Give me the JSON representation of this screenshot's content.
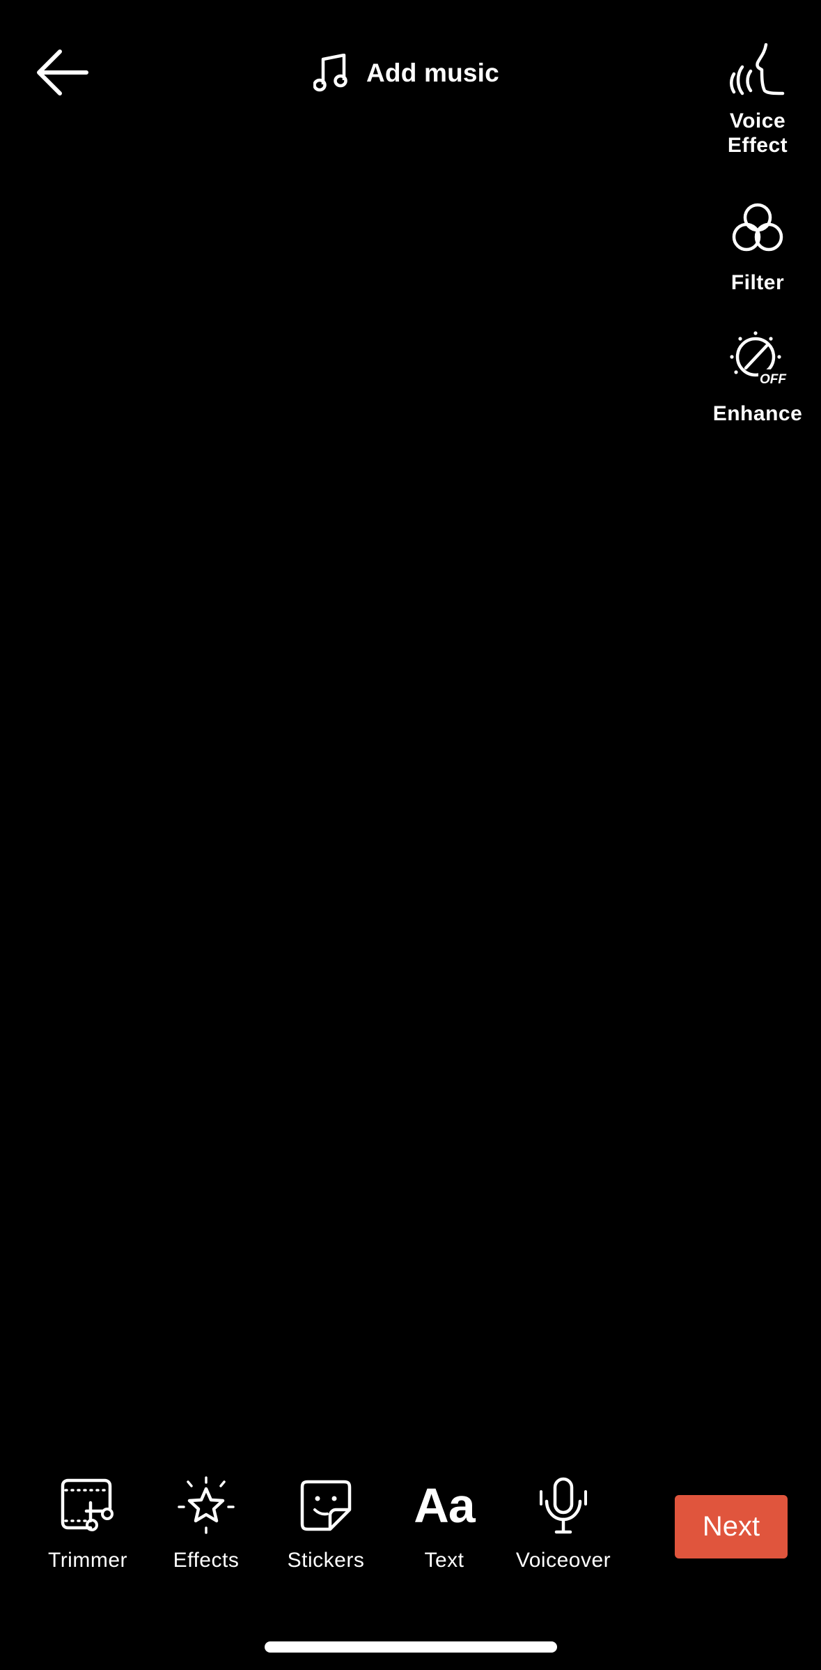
{
  "header": {
    "add_music_label": "Add music"
  },
  "side_tools": {
    "voice_effect_line1": "Voice",
    "voice_effect_line2": "Effect",
    "filter": "Filter",
    "enhance": "Enhance",
    "enhance_state": "OFF"
  },
  "bottom_tools": {
    "trimmer": "Trimmer",
    "effects": "Effects",
    "stickers": "Stickers",
    "text": "Text",
    "text_icon_glyph": "Aa",
    "voiceover": "Voiceover"
  },
  "next_label": "Next",
  "colors": {
    "background": "#000000",
    "foreground": "#FFFFFF",
    "accent": "#E0553D"
  },
  "icons": {
    "back": "arrow-left-icon",
    "music": "music-note-icon",
    "voice_effect": "voice-wave-icon",
    "filter": "three-circles-icon",
    "enhance": "dial-off-icon",
    "trimmer": "scissors-frame-icon",
    "effects": "sparkle-star-icon",
    "stickers": "sticker-icon",
    "text": "text-aa-icon",
    "voiceover": "microphone-icon"
  }
}
